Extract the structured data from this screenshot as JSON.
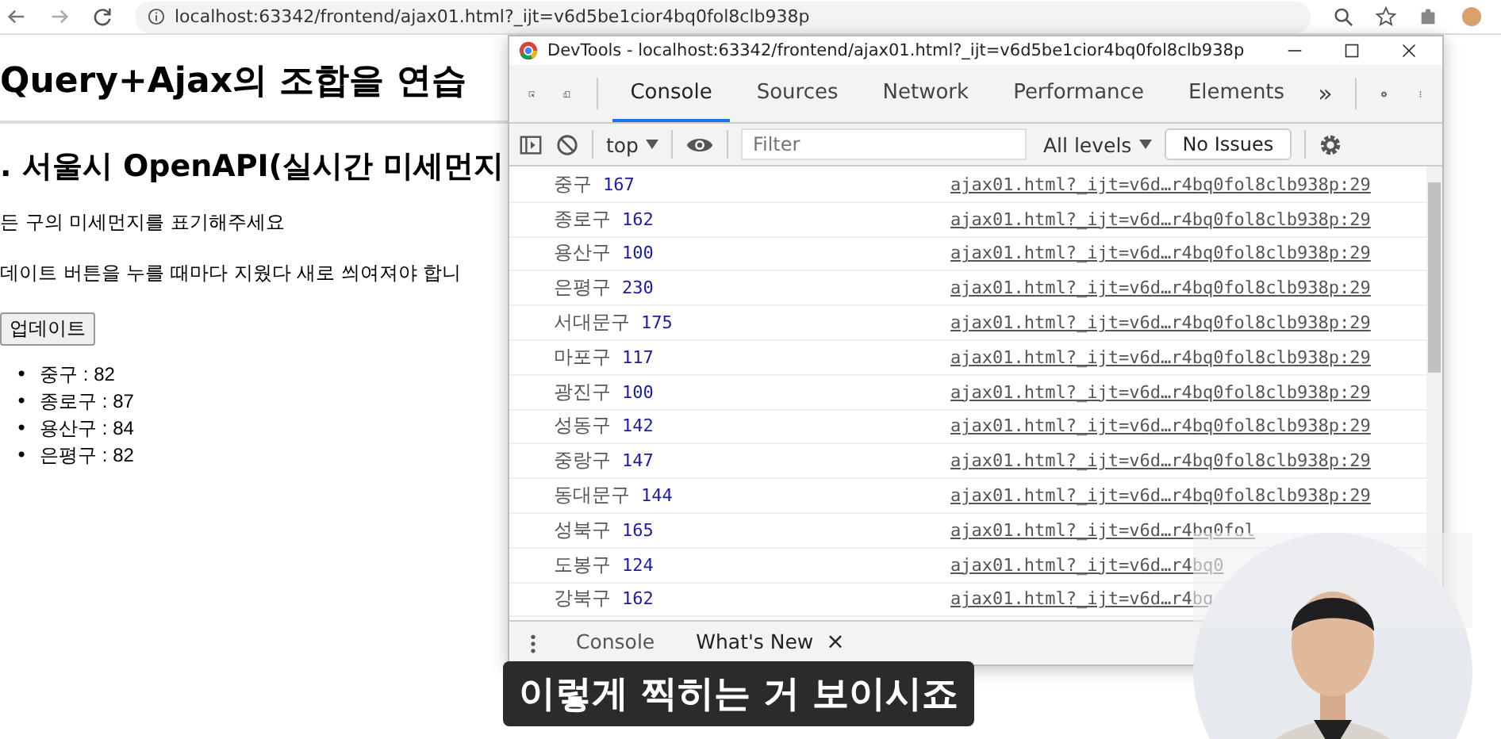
{
  "browser": {
    "url": "localhost:63342/frontend/ajax01.html?_ijt=v6d5be1cior4bq0fol8clb938p"
  },
  "page": {
    "heading": "Query+Ajax의 조합을 연습",
    "subheading": ". 서울시 OpenAPI(실시간 미세먼지",
    "paragraphs": [
      "든 구의 미세먼지를 표기해주세요",
      "데이트 버튼을 누를 때마다 지웠다 새로 씌여져야 합니"
    ],
    "button": "업데이트",
    "bullet": "•",
    "list": [
      "중구 : 82",
      "종로구 : 87",
      "용산구 : 84",
      "은평구 : 82"
    ]
  },
  "devtools": {
    "title": "DevTools - localhost:63342/frontend/ajax01.html?_ijt=v6d5be1cior4bq0fol8clb938p",
    "tabs": [
      {
        "label": "Console",
        "selected": true
      },
      {
        "label": "Sources",
        "selected": false
      },
      {
        "label": "Network",
        "selected": false
      },
      {
        "label": "Performance",
        "selected": false
      },
      {
        "label": "Elements",
        "selected": false
      }
    ],
    "more": "»",
    "context": "top",
    "filter": {
      "placeholder": "Filter"
    },
    "levels": "All levels",
    "issues": "No Issues",
    "logs": [
      {
        "name": "중구",
        "value": "167",
        "source": "ajax01.html?_ijt=v6d…r4bq0fol8clb938p:29"
      },
      {
        "name": "종로구",
        "value": "162",
        "source": "ajax01.html?_ijt=v6d…r4bq0fol8clb938p:29"
      },
      {
        "name": "용산구",
        "value": "100",
        "source": "ajax01.html?_ijt=v6d…r4bq0fol8clb938p:29"
      },
      {
        "name": "은평구",
        "value": "230",
        "source": "ajax01.html?_ijt=v6d…r4bq0fol8clb938p:29"
      },
      {
        "name": "서대문구",
        "value": "175",
        "source": "ajax01.html?_ijt=v6d…r4bq0fol8clb938p:29"
      },
      {
        "name": "마포구",
        "value": "117",
        "source": "ajax01.html?_ijt=v6d…r4bq0fol8clb938p:29"
      },
      {
        "name": "광진구",
        "value": "100",
        "source": "ajax01.html?_ijt=v6d…r4bq0fol8clb938p:29"
      },
      {
        "name": "성동구",
        "value": "142",
        "source": "ajax01.html?_ijt=v6d…r4bq0fol8clb938p:29"
      },
      {
        "name": "중랑구",
        "value": "147",
        "source": "ajax01.html?_ijt=v6d…r4bq0fol8clb938p:29"
      },
      {
        "name": "동대문구",
        "value": "144",
        "source": "ajax01.html?_ijt=v6d…r4bq0fol8clb938p:29"
      },
      {
        "name": "성북구",
        "value": "165",
        "source": "ajax01.html?_ijt=v6d…r4bq0fol"
      },
      {
        "name": "도봉구",
        "value": "124",
        "source": "ajax01.html?_ijt=v6d…r4bq0"
      },
      {
        "name": "강북구",
        "value": "162",
        "source": "ajax01.html?_ijt=v6d…r4bq"
      }
    ],
    "drawer_tabs": [
      {
        "label": "Console",
        "selected": false,
        "closable": false
      },
      {
        "label": "What's New",
        "selected": true,
        "closable": true
      }
    ],
    "close": "×"
  },
  "caption": "이렇게 찍히는 거 보이시죠"
}
